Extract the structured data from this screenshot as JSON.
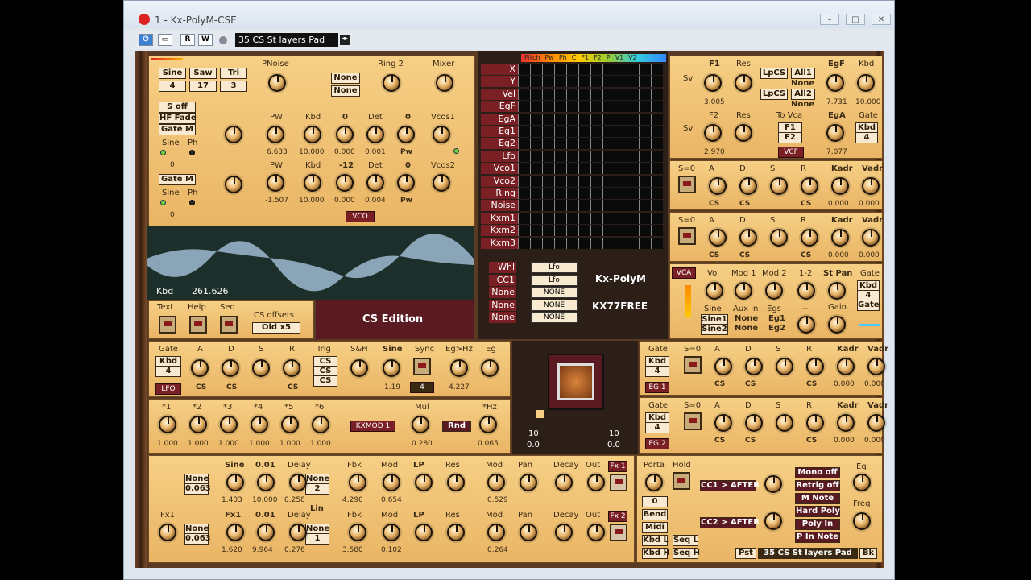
{
  "window": {
    "title": "1 - Kx-PolyM-CSE",
    "preset": "35 CS St layers Pad",
    "toolbar": {
      "r": "R",
      "w": "W"
    }
  },
  "vco": {
    "shapes": [
      "Sine",
      "Saw",
      "Tri"
    ],
    "shape_vals": [
      "4",
      "17",
      "3"
    ],
    "soff": "S off",
    "hf": "HF Fade",
    "gate_m1": "Gate M",
    "gate_m2": "Gate M",
    "labels": {
      "pnoise": "PNoise",
      "ring2": "Ring 2",
      "mixer": "Mixer",
      "none1": "None",
      "none2": "None",
      "pw": "PW",
      "kbd": "Kbd",
      "zero": "0",
      "det": "Det",
      "vcos1": "Vcos1",
      "vcos2": "Vcos2",
      "minus12": "-12",
      "sine": "Sine",
      "ph": "Ph",
      "pw_label": "Pw"
    },
    "row1": [
      "6.633",
      "10.000",
      "0.000",
      "0.001"
    ],
    "row2": [
      "-1.507",
      "10.000",
      "0.000",
      "0.004"
    ],
    "zero_a": "0",
    "zero_b": "0",
    "tag": "VCO"
  },
  "scope": {
    "kbd_label": "Kbd",
    "kbd_val": "261.626"
  },
  "bottom_left": {
    "text": "Text",
    "help": "Help",
    "seq": "Seq",
    "cs_offsets": "CS offsets",
    "old": "Old x5",
    "edition": "CS Edition"
  },
  "matrix": {
    "header": [
      "Pitch",
      "Pw",
      "Ph",
      "C",
      "F1",
      "F2",
      "P",
      "V1",
      "V2"
    ],
    "rows": [
      "X",
      "Y",
      "Vel",
      "EgF",
      "EgA",
      "Eg1",
      "Eg2",
      "Lfo",
      "Vco1",
      "Vco2",
      "Ring",
      "Noise",
      "Kxm1",
      "Kxm2",
      "Kxm3"
    ],
    "ctrl": [
      {
        "l": "Whl",
        "v": "Lfo"
      },
      {
        "l": "CC1",
        "v": "Lfo"
      },
      {
        "l": "None",
        "v": "NONE"
      },
      {
        "l": "None",
        "v": "NONE"
      },
      {
        "l": "None",
        "v": "NONE"
      }
    ],
    "brand": "Kx-PolyM",
    "free": "KX77FREE"
  },
  "vcf": {
    "f1": "F1",
    "res": "Res",
    "sv": "Sv",
    "f2": "F2",
    "lpcs1": "LpCS",
    "all1": "All1",
    "none1": "None",
    "lpcs2": "LpCS",
    "all2": "All2",
    "none2": "None",
    "egf": "EgF",
    "kbd": "Kbd",
    "eg_a": "EgA",
    "gate": "Gate",
    "tovca": "To Vca",
    "f1b": "F1",
    "f2b": "F2",
    "tag": "VCF",
    "v1": "3.005",
    "v2": "2.970",
    "v3": "7.731",
    "v4": "10.000",
    "v5": "7.077",
    "gate_kbd": "Kbd",
    "gate_4": "4"
  },
  "env": {
    "s0": "S=0",
    "a": "A",
    "d": "D",
    "s": "S",
    "r": "R",
    "kadr": "Kadr",
    "vadr": "Vadr",
    "cs": "CS",
    "zero": "0.000"
  },
  "vca": {
    "tag": "VCA",
    "vol": "Vol",
    "mod1": "Mod 1",
    "mod2": "Mod 2",
    "one2": "1-2",
    "stpan": "St Pan",
    "gate": "Gate",
    "kbd": "Kbd",
    "four": "4",
    "gate2": "Gate",
    "sine": "Sine",
    "auxin": "Aux in",
    "egs": "Egs",
    "sine1": "Sine1",
    "sine2": "Sine2",
    "none1": "None",
    "none2": "None",
    "eg1": "Eg1",
    "eg2": "Eg2",
    "gain": "Gain",
    "dash1": "--",
    "dash2": "--"
  },
  "lfo": {
    "gate": "Gate",
    "kbd": "Kbd",
    "four": "4",
    "tag": "LFO",
    "a": "A",
    "d": "D",
    "s": "S",
    "r": "R",
    "trig": "Trig",
    "cs": "CS",
    "sh": "S&H",
    "sine": "Sine",
    "sync": "Sync",
    "eghz": "Eg>Hz",
    "eg": "Eg",
    "v1": "1.19",
    "v2": "4",
    "v3": "4.227"
  },
  "kxmod": {
    "labels": [
      "*1",
      "*2",
      "*3",
      "*4",
      "*5",
      "*6"
    ],
    "vals": [
      "1.000",
      "1.000",
      "1.000",
      "1.000",
      "1.000",
      "1.000"
    ],
    "tag": "KXMOD 1",
    "mul": "Mul",
    "mulv": "0.280",
    "rnd": "Rnd",
    "hz": "*Hz",
    "hzv": "0.065"
  },
  "xy": {
    "n1": "10",
    "n2": "0.0",
    "n3": "10",
    "n4": "0.0"
  },
  "eg1": {
    "gate": "Gate",
    "kbd": "Kbd",
    "four": "4",
    "tag": "EG 1"
  },
  "eg2": {
    "gate": "Gate",
    "kbd": "Kbd",
    "four": "4",
    "tag": "EG 2"
  },
  "fx": {
    "r1": {
      "none": "None",
      "nv": "0.063",
      "sine": "Sine",
      "p01": "0.01",
      "delay": "Delay",
      "none2": "None",
      "two": "2",
      "fbk": "Fbk",
      "mod": "Mod",
      "lp": "LP",
      "res": "Res",
      "mod2": "Mod",
      "pan": "Pan",
      "decay": "Decay",
      "out": "Out",
      "fx": "Fx 1",
      "vals": [
        "1.403",
        "10.000",
        "0.258",
        "4.290",
        "0.654",
        "0.529"
      ]
    },
    "r2": {
      "fx1": "Fx1",
      "none": "None",
      "nv": "0.063",
      "fx1b": "Fx1",
      "p01": "0.01",
      "delay": "Delay",
      "lin": "Lin",
      "none2": "None",
      "one": "1",
      "fbk": "Fbk",
      "mod": "Mod",
      "lp": "LP",
      "res": "Res",
      "mod2": "Mod",
      "pan": "Pan",
      "decay": "Decay",
      "out": "Out",
      "fx": "Fx 2",
      "vals": [
        "1.620",
        "9.964",
        "0.276",
        "3.580",
        "0.102",
        "0.264"
      ]
    }
  },
  "perf": {
    "porta": "Porta",
    "hold": "Hold",
    "zero": "0",
    "bend": "Bend",
    "midi": "Midi",
    "kbdl": "Kbd L",
    "kbdh": "Kbd H",
    "seql": "Seq L",
    "seqh": "Seq H",
    "cc1": "CC1 > AFTER",
    "cc2": "CC2 > AFTER",
    "mono": "Mono off",
    "retrig": "Retrig off",
    "mnote": "M Note",
    "hard": "Hard Poly",
    "polyin": "Poly In",
    "pinnote": "P In Note",
    "eq": "Eq",
    "freq": "Freq",
    "pst": "Pst",
    "preset": "35 CS St layers Pad",
    "bk": "Bk"
  }
}
